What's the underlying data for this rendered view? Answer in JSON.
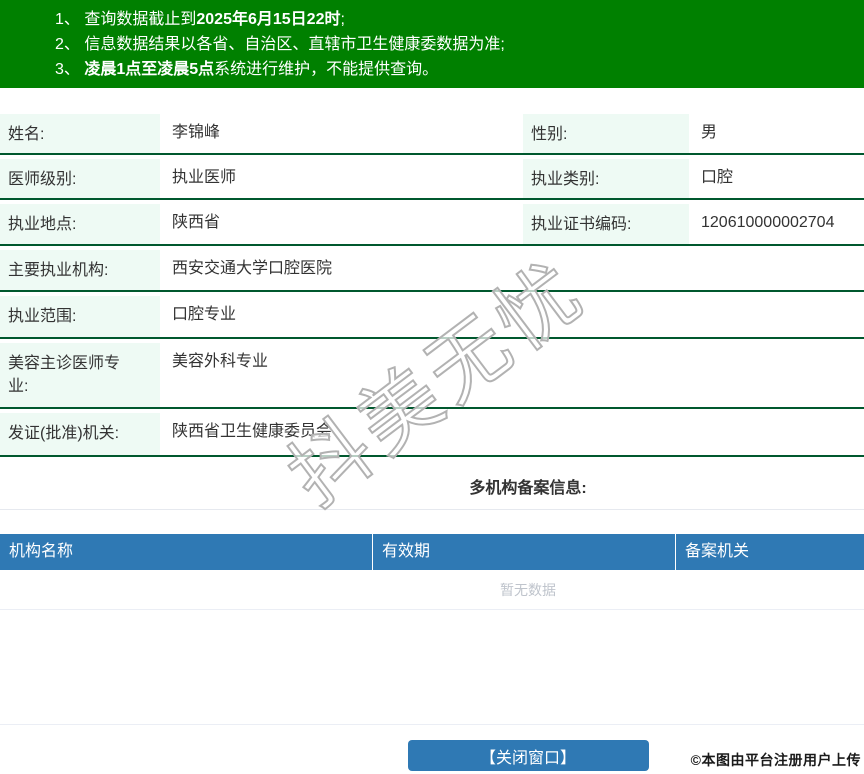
{
  "notice": {
    "items": [
      {
        "num": "1、",
        "pre": "查询数据截止到",
        "bold": "2025年6月15日22时",
        "post": ";"
      },
      {
        "num": "2、",
        "pre": "信息数据结果以各省、自治区、直辖市卫生健康委数据为准;",
        "bold": "",
        "post": ""
      },
      {
        "num": "3、",
        "pre": "",
        "bold": "凌晨1点至凌晨5点",
        "post": "系统进行维护，不能提供查询。"
      }
    ]
  },
  "profile": {
    "name_label": "姓名:",
    "name_value": "李锦峰",
    "gender_label": "性别:",
    "gender_value": "男",
    "level_label": "医师级别:",
    "level_value": "执业医师",
    "category_label": "执业类别:",
    "category_value": "口腔",
    "location_label": "执业地点:",
    "location_value": "陕西省",
    "cert_label": "执业证书编码:",
    "cert_value": "120610000002704",
    "org_label": "主要执业机构:",
    "org_value": "西安交通大学口腔医院",
    "scope_label": "执业范围:",
    "scope_value": "口腔专业",
    "cosmetic_label": "美容主诊医师专业:",
    "cosmetic_value": "美容外科专业",
    "issuer_label": "发证(批准)机关:",
    "issuer_value": "陕西省卫生健康委员会"
  },
  "multi_org": {
    "title": "多机构备案信息:",
    "columns": [
      "机构名称",
      "有效期",
      "备案机关"
    ],
    "empty_text": "暂无数据"
  },
  "footer": {
    "close_button": "【关闭窗口】",
    "copyright": "©本图由平台注册用户上传"
  },
  "watermark": {
    "text": "抖美无忧"
  },
  "colors": {
    "notice_green": "#008000",
    "row_border_green": "#00582e",
    "label_mint": "#eefaf4",
    "accent_blue": "#2f79b4",
    "empty_text_gray": "#bfc4cc"
  }
}
